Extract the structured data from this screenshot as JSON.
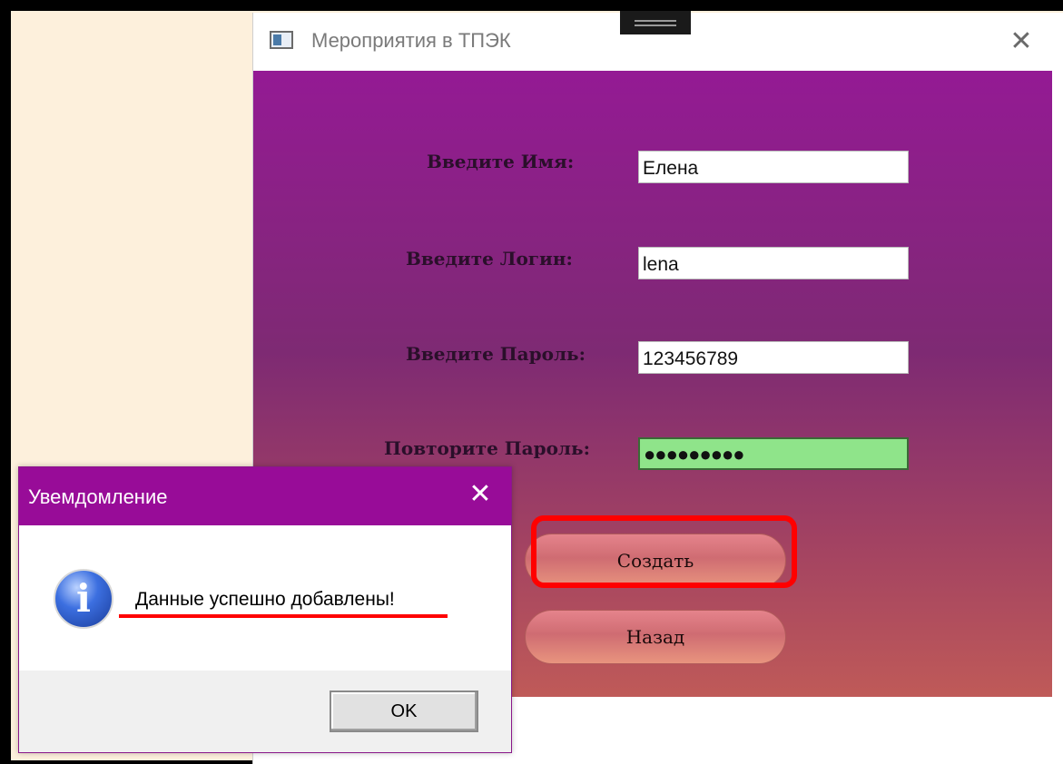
{
  "main_window": {
    "title": "Мероприятия в ТПЭК",
    "close_glyph": "✕",
    "fields": [
      {
        "label": "Введите Имя:",
        "value": "Елена"
      },
      {
        "label": "Введите Логин:",
        "value": "lena"
      },
      {
        "label": "Введите Пароль:",
        "value": "123456789"
      },
      {
        "label": "Повторите Пароль:",
        "value": "●●●●●●●●●"
      }
    ],
    "create_button": "Создать",
    "back_button": "Назад"
  },
  "dialog": {
    "title": "Увемдомление",
    "close_glyph": "✕",
    "message": "Данные успешно добавлены!",
    "icon_glyph": "i",
    "ok_button": "OK"
  },
  "colors": {
    "dialog_titlebar": "#980c98",
    "highlight": "#ff0000",
    "password_match": "#8fe48a"
  },
  "icons": [
    "app-window-icon",
    "close-icon",
    "info-icon"
  ]
}
